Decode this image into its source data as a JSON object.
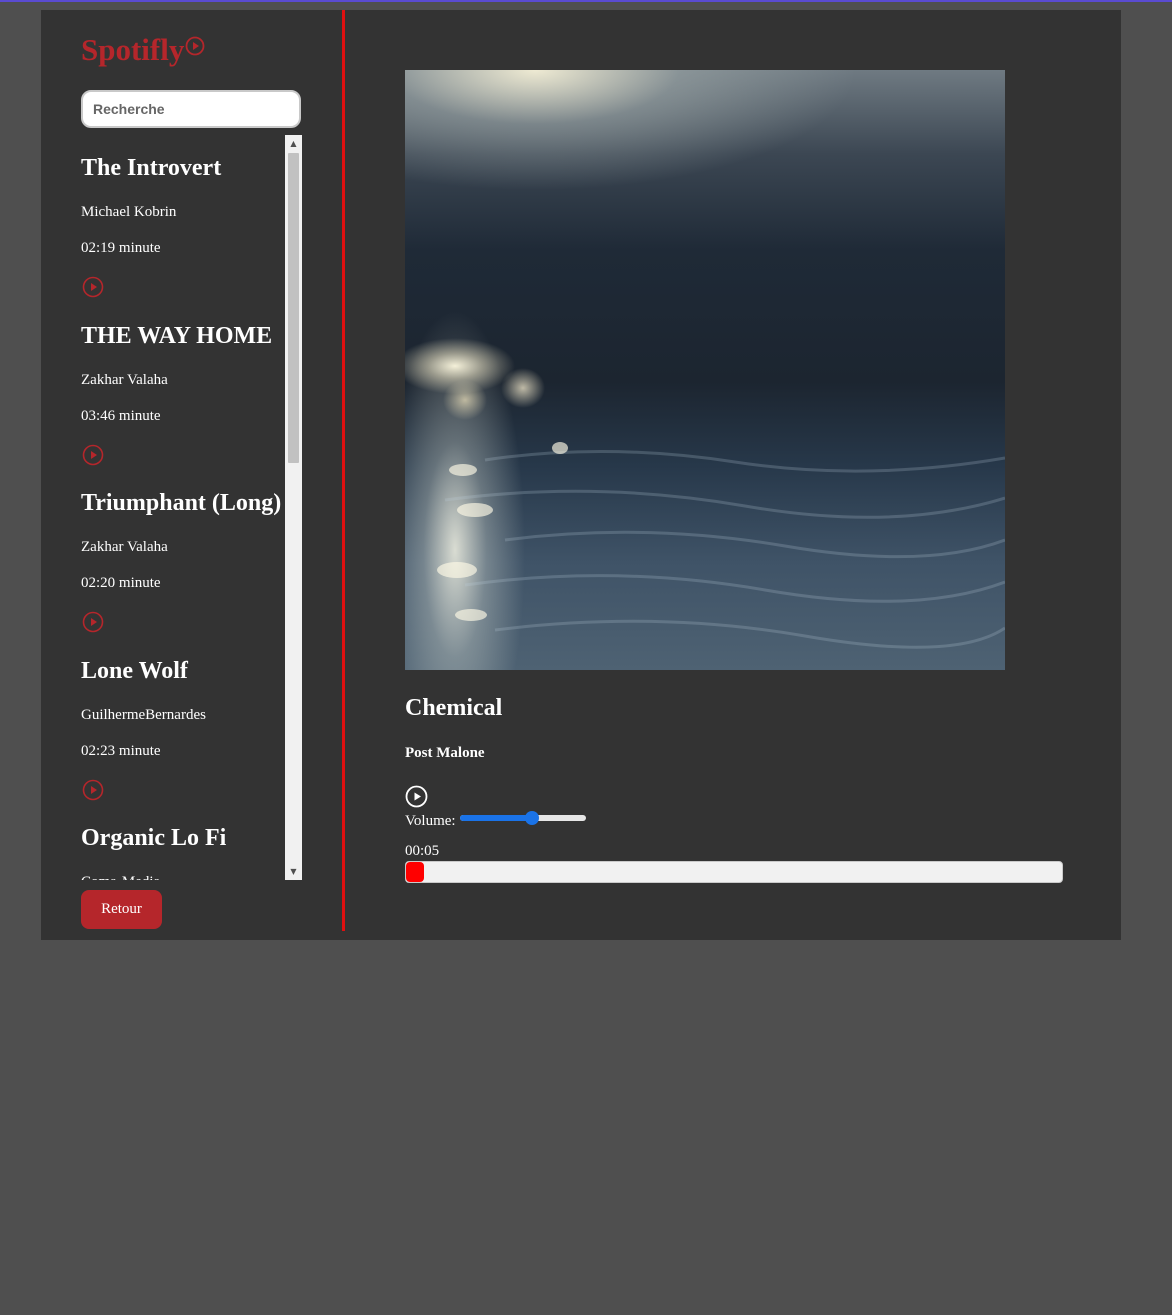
{
  "app": {
    "logo": "Spotifly"
  },
  "search": {
    "placeholder": "Recherche"
  },
  "tracks": [
    {
      "title": "The Introvert",
      "artist": "Michael Kobrin",
      "duration": "02:19 minute"
    },
    {
      "title": "THE WAY HOME",
      "artist": "Zakhar Valaha",
      "duration": "03:46 minute"
    },
    {
      "title": "Triumphant (Long)",
      "artist": "Zakhar Valaha",
      "duration": "02:20 minute"
    },
    {
      "title": "Lone Wolf",
      "artist": "GuilhermeBernardes",
      "duration": "02:23 minute"
    },
    {
      "title": "Organic Lo Fi",
      "artist": "Coma-Media",
      "duration": ""
    }
  ],
  "back_button": {
    "label": "Retour"
  },
  "player": {
    "title": "Chemical",
    "artist": "Post Malone",
    "volume_label": "Volume:",
    "volume": 0.57,
    "current_time": "00:05",
    "progress": 0.02
  },
  "colors": {
    "accent": "#b5262b",
    "divider": "#e01010",
    "volume": "#1a73e8",
    "progress": "#ff0000"
  },
  "icons": {
    "logo": "play-circle-icon",
    "track_play": "play-circle-icon",
    "main_play": "play-circle-icon"
  }
}
